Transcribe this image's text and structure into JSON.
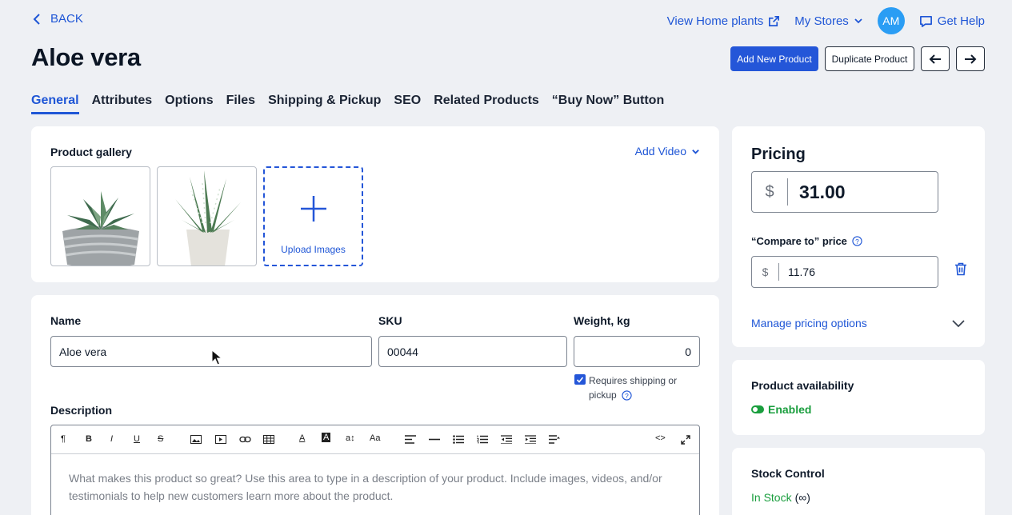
{
  "nav": {
    "back_label": "BACK"
  },
  "header": {
    "view_link": "View Home plants",
    "my_stores": "My Stores",
    "avatar_initials": "AM",
    "help": "Get Help"
  },
  "page": {
    "title": "Aloe vera"
  },
  "actions": {
    "add_new": "Add New Product",
    "duplicate": "Duplicate Product"
  },
  "tabs": [
    "General",
    "Attributes",
    "Options",
    "Files",
    "Shipping & Pickup",
    "SEO",
    "Related Products",
    "“Buy Now” Button"
  ],
  "gallery": {
    "label": "Product gallery",
    "add_video": "Add Video",
    "upload_label": "Upload Images"
  },
  "fields": {
    "name_label": "Name",
    "name_value": "Aloe vera",
    "sku_label": "SKU",
    "sku_value": "00044",
    "weight_label": "Weight, kg",
    "weight_value": "0",
    "shipping_line1": "Requires shipping or",
    "shipping_line2": "pickup",
    "description_label": "Description",
    "description_placeholder_1": "What makes this product so great? Use this area to type in a description of your product. Include images, videos, and/or",
    "description_placeholder_2": "testimonials to help new customers learn more about the product."
  },
  "pricing": {
    "title": "Pricing",
    "currency": "$",
    "price": "31.00",
    "compare_label": "“Compare to” price",
    "compare_value": "11.76",
    "manage": "Manage pricing options"
  },
  "availability": {
    "title": "Product availability",
    "status": "Enabled"
  },
  "stock": {
    "title": "Stock Control",
    "status": "In Stock",
    "qty": "(∞)"
  },
  "colors": {
    "accent": "#2456d8",
    "link": "#1f56d6",
    "success": "#1a9e3e",
    "avatar": "#2a9df4"
  }
}
